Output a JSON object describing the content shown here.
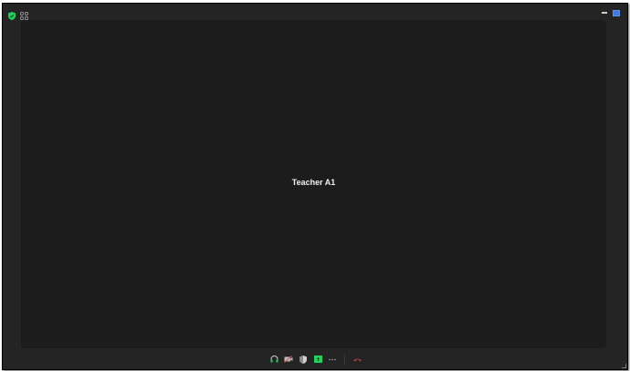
{
  "participant": {
    "name": "Teacher A1"
  },
  "icons": {
    "security": "shield-check-icon",
    "layout": "grid-view-icon",
    "minimize": "minimize-icon",
    "maximize": "maximize-icon",
    "toolbar": [
      "headphones-icon",
      "camera-off-icon",
      "shield-icon",
      "share-screen-icon",
      "more-icon",
      "hang-up-icon"
    ]
  },
  "colors": {
    "accent_green": "#1fd25a",
    "danger_red": "#e5484d",
    "window_blue": "#3d7be0"
  }
}
